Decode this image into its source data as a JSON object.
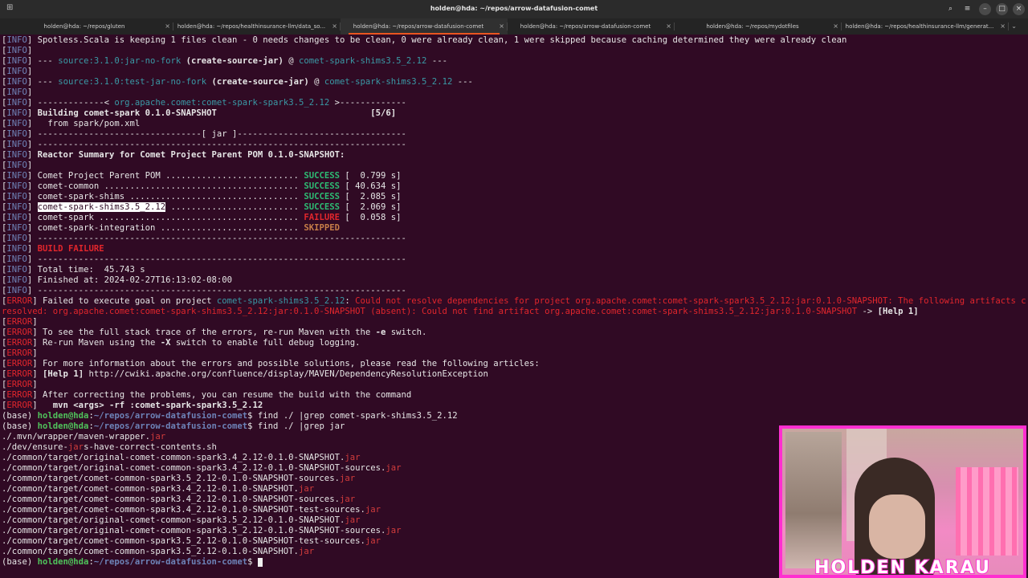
{
  "titlebar": {
    "title": "holden@hda: ~/repos/arrow-datafusion-comet",
    "newtab_icon": "new-tab-icon",
    "search_icon": "search-icon",
    "menu_icon": "hamburger-icon"
  },
  "tabs": [
    {
      "label": "holden@hda: ~/repos/gluten",
      "active": false
    },
    {
      "label": "holden@hda: ~/repos/healthinsurance-llm/data_so...",
      "active": false
    },
    {
      "label": "holden@hda: ~/repos/arrow-datafusion-comet",
      "active": true
    },
    {
      "label": "holden@hda: ~/repos/arrow-datafusion-comet",
      "active": false
    },
    {
      "label": "holden@hda: ~/repos/mydotfiles",
      "active": false
    },
    {
      "label": "holden@hda: ~/repos/healthinsurance-llm/generat...",
      "active": false
    }
  ],
  "colors": {
    "background": "#300a24",
    "info": "#6f84b8",
    "error": "#e2262c",
    "success": "#2dbb73",
    "skipped": "#c67d48",
    "prompt": "#4fc35b",
    "webcam_border": "#ff2fd0"
  },
  "terminal": {
    "lines": [
      [
        {
          "t": "[",
          "c": ""
        },
        {
          "t": "INFO",
          "c": "info"
        },
        {
          "t": "] Spotless.Scala is keeping 1 files clean - 0 needs changes to be clean, 0 were already clean, 1 were skipped because caching determined they were already clean",
          "c": ""
        }
      ],
      [
        {
          "t": "[",
          "c": ""
        },
        {
          "t": "INFO",
          "c": "info"
        },
        {
          "t": "]",
          "c": ""
        }
      ],
      [
        {
          "t": "[",
          "c": ""
        },
        {
          "t": "INFO",
          "c": "info"
        },
        {
          "t": "] --- ",
          "c": ""
        },
        {
          "t": "source:3.1.0:jar-no-fork",
          "c": "teal"
        },
        {
          "t": " ",
          "c": ""
        },
        {
          "t": "(create-source-jar)",
          "c": "b"
        },
        {
          "t": " @ ",
          "c": ""
        },
        {
          "t": "comet-spark-shims3.5_2.12",
          "c": "teal"
        },
        {
          "t": " ---",
          "c": ""
        }
      ],
      [
        {
          "t": "[",
          "c": ""
        },
        {
          "t": "INFO",
          "c": "info"
        },
        {
          "t": "]",
          "c": ""
        }
      ],
      [
        {
          "t": "[",
          "c": ""
        },
        {
          "t": "INFO",
          "c": "info"
        },
        {
          "t": "] --- ",
          "c": ""
        },
        {
          "t": "source:3.1.0:test-jar-no-fork",
          "c": "teal"
        },
        {
          "t": " ",
          "c": ""
        },
        {
          "t": "(create-source-jar)",
          "c": "b"
        },
        {
          "t": " @ ",
          "c": ""
        },
        {
          "t": "comet-spark-shims3.5_2.12",
          "c": "teal"
        },
        {
          "t": " ---",
          "c": ""
        }
      ],
      [
        {
          "t": "[",
          "c": ""
        },
        {
          "t": "INFO",
          "c": "info"
        },
        {
          "t": "]",
          "c": ""
        }
      ],
      [
        {
          "t": "[",
          "c": ""
        },
        {
          "t": "INFO",
          "c": "info"
        },
        {
          "t": "] -------------< ",
          "c": ""
        },
        {
          "t": "org.apache.comet:comet-spark-spark3.5_2.12",
          "c": "teal"
        },
        {
          "t": " >-------------",
          "c": ""
        }
      ],
      [
        {
          "t": "[",
          "c": ""
        },
        {
          "t": "INFO",
          "c": "info"
        },
        {
          "t": "] ",
          "c": ""
        },
        {
          "t": "Building comet-spark 0.1.0-SNAPSHOT                              [5/6]",
          "c": "b"
        }
      ],
      [
        {
          "t": "[",
          "c": ""
        },
        {
          "t": "INFO",
          "c": "info"
        },
        {
          "t": "]   from spark/pom.xml",
          "c": ""
        }
      ],
      [
        {
          "t": "[",
          "c": ""
        },
        {
          "t": "INFO",
          "c": "info"
        },
        {
          "t": "] --------------------------------[ jar ]---------------------------------",
          "c": ""
        }
      ],
      [
        {
          "t": "[",
          "c": ""
        },
        {
          "t": "INFO",
          "c": "info"
        },
        {
          "t": "] ------------------------------------------------------------------------",
          "c": ""
        }
      ],
      [
        {
          "t": "[",
          "c": ""
        },
        {
          "t": "INFO",
          "c": "info"
        },
        {
          "t": "] ",
          "c": ""
        },
        {
          "t": "Reactor Summary for Comet Project Parent POM 0.1.0-SNAPSHOT:",
          "c": "b"
        }
      ],
      [
        {
          "t": "[",
          "c": ""
        },
        {
          "t": "INFO",
          "c": "info"
        },
        {
          "t": "]",
          "c": ""
        }
      ],
      [
        {
          "t": "[",
          "c": ""
        },
        {
          "t": "INFO",
          "c": "info"
        },
        {
          "t": "] Comet Project Parent POM .......................... ",
          "c": ""
        },
        {
          "t": "SUCCESS",
          "c": "green"
        },
        {
          "t": " [  0.799 s]",
          "c": ""
        }
      ],
      [
        {
          "t": "[",
          "c": ""
        },
        {
          "t": "INFO",
          "c": "info"
        },
        {
          "t": "] comet-common ...................................... ",
          "c": ""
        },
        {
          "t": "SUCCESS",
          "c": "green"
        },
        {
          "t": " [ 40.634 s]",
          "c": ""
        }
      ],
      [
        {
          "t": "[",
          "c": ""
        },
        {
          "t": "INFO",
          "c": "info"
        },
        {
          "t": "] comet-spark-shims ................................. ",
          "c": ""
        },
        {
          "t": "SUCCESS",
          "c": "green"
        },
        {
          "t": " [  2.085 s]",
          "c": ""
        }
      ],
      [
        {
          "t": "[",
          "c": ""
        },
        {
          "t": "INFO",
          "c": "info"
        },
        {
          "t": "] ",
          "c": ""
        },
        {
          "t": "comet-spark-shims3.5_2.12",
          "c": "hl"
        },
        {
          "t": " ......................... ",
          "c": ""
        },
        {
          "t": "SUCCESS",
          "c": "green"
        },
        {
          "t": " [  2.069 s]",
          "c": ""
        }
      ],
      [
        {
          "t": "[",
          "c": ""
        },
        {
          "t": "INFO",
          "c": "info"
        },
        {
          "t": "] comet-spark ....................................... ",
          "c": ""
        },
        {
          "t": "FAILURE",
          "c": "red"
        },
        {
          "t": " [  0.058 s]",
          "c": ""
        }
      ],
      [
        {
          "t": "[",
          "c": ""
        },
        {
          "t": "INFO",
          "c": "info"
        },
        {
          "t": "] comet-spark-integration ........................... ",
          "c": ""
        },
        {
          "t": "SKIPPED",
          "c": "amber"
        }
      ],
      [
        {
          "t": "[",
          "c": ""
        },
        {
          "t": "INFO",
          "c": "info"
        },
        {
          "t": "] ------------------------------------------------------------------------",
          "c": ""
        }
      ],
      [
        {
          "t": "[",
          "c": ""
        },
        {
          "t": "INFO",
          "c": "info"
        },
        {
          "t": "] ",
          "c": ""
        },
        {
          "t": "BUILD FAILURE",
          "c": "red"
        }
      ],
      [
        {
          "t": "[",
          "c": ""
        },
        {
          "t": "INFO",
          "c": "info"
        },
        {
          "t": "] ------------------------------------------------------------------------",
          "c": ""
        }
      ],
      [
        {
          "t": "[",
          "c": ""
        },
        {
          "t": "INFO",
          "c": "info"
        },
        {
          "t": "] Total time:  45.743 s",
          "c": ""
        }
      ],
      [
        {
          "t": "[",
          "c": ""
        },
        {
          "t": "INFO",
          "c": "info"
        },
        {
          "t": "] Finished at: 2024-02-27T16:13:02-08:00",
          "c": ""
        }
      ],
      [
        {
          "t": "[",
          "c": ""
        },
        {
          "t": "INFO",
          "c": "info"
        },
        {
          "t": "] ------------------------------------------------------------------------",
          "c": ""
        }
      ],
      [
        {
          "t": "[",
          "c": ""
        },
        {
          "t": "ERROR",
          "c": "err"
        },
        {
          "t": "] Failed to execute goal on project ",
          "c": ""
        },
        {
          "t": "comet-spark-shims3.5_2.12",
          "c": "teal"
        },
        {
          "t": ": ",
          "c": ""
        },
        {
          "t": "Could not resolve dependencies for project org.apache.comet:comet-spark-spark3.5_2.12:jar:0.1.0-SNAPSHOT: The following artifacts could not be",
          "c": "err"
        }
      ],
      [
        {
          "t": "resolved: org.apache.comet:comet-spark-shims3.5_2.12:jar:0.1.0-SNAPSHOT (absent): Could not find artifact org.apache.comet:comet-spark-shims3.5_2.12:jar:0.1.0-SNAPSHOT",
          "c": "err"
        },
        {
          "t": " -> ",
          "c": ""
        },
        {
          "t": "[Help 1]",
          "c": "b"
        }
      ],
      [
        {
          "t": "[",
          "c": ""
        },
        {
          "t": "ERROR",
          "c": "err"
        },
        {
          "t": "]",
          "c": ""
        }
      ],
      [
        {
          "t": "[",
          "c": ""
        },
        {
          "t": "ERROR",
          "c": "err"
        },
        {
          "t": "] To see the full stack trace of the errors, re-run Maven with the ",
          "c": ""
        },
        {
          "t": "-e",
          "c": "b"
        },
        {
          "t": " switch.",
          "c": ""
        }
      ],
      [
        {
          "t": "[",
          "c": ""
        },
        {
          "t": "ERROR",
          "c": "err"
        },
        {
          "t": "] Re-run Maven using the ",
          "c": ""
        },
        {
          "t": "-X",
          "c": "b"
        },
        {
          "t": " switch to enable full debug logging.",
          "c": ""
        }
      ],
      [
        {
          "t": "[",
          "c": ""
        },
        {
          "t": "ERROR",
          "c": "err"
        },
        {
          "t": "]",
          "c": ""
        }
      ],
      [
        {
          "t": "[",
          "c": ""
        },
        {
          "t": "ERROR",
          "c": "err"
        },
        {
          "t": "] For more information about the errors and possible solutions, please read the following articles:",
          "c": ""
        }
      ],
      [
        {
          "t": "[",
          "c": ""
        },
        {
          "t": "ERROR",
          "c": "err"
        },
        {
          "t": "] ",
          "c": ""
        },
        {
          "t": "[Help 1]",
          "c": "b"
        },
        {
          "t": " http://cwiki.apache.org/confluence/display/MAVEN/DependencyResolutionException",
          "c": ""
        }
      ],
      [
        {
          "t": "[",
          "c": ""
        },
        {
          "t": "ERROR",
          "c": "err"
        },
        {
          "t": "]",
          "c": ""
        }
      ],
      [
        {
          "t": "[",
          "c": ""
        },
        {
          "t": "ERROR",
          "c": "err"
        },
        {
          "t": "] After correcting the problems, you can resume the build with the command",
          "c": ""
        }
      ],
      [
        {
          "t": "[",
          "c": ""
        },
        {
          "t": "ERROR",
          "c": "err"
        },
        {
          "t": "]   ",
          "c": ""
        },
        {
          "t": "mvn <args> -rf :comet-spark-spark3.5_2.12",
          "c": "b"
        }
      ],
      [
        {
          "t": "(base) ",
          "c": ""
        },
        {
          "t": "holden@hda",
          "c": "prompt"
        },
        {
          "t": ":",
          "c": ""
        },
        {
          "t": "~/repos/arrow-datafusion-comet",
          "c": "path"
        },
        {
          "t": "$ find ./ |grep comet-spark-shims3.5_2.12",
          "c": ""
        }
      ],
      [
        {
          "t": "(base) ",
          "c": ""
        },
        {
          "t": "holden@hda",
          "c": "prompt"
        },
        {
          "t": ":",
          "c": ""
        },
        {
          "t": "~/repos/arrow-datafusion-comet",
          "c": "path"
        },
        {
          "t": "$ find ./ |grep jar",
          "c": ""
        }
      ],
      [
        {
          "t": "./.mvn/wrapper/maven-wrapper.",
          "c": ""
        },
        {
          "t": "jar",
          "c": "jar"
        }
      ],
      [
        {
          "t": "./dev/ensure-",
          "c": ""
        },
        {
          "t": "jar",
          "c": "jar"
        },
        {
          "t": "s-have-correct-contents.sh",
          "c": ""
        }
      ],
      [
        {
          "t": "./common/target/original-comet-common-spark3.4_2.12-0.1.0-SNAPSHOT.",
          "c": ""
        },
        {
          "t": "jar",
          "c": "jar"
        }
      ],
      [
        {
          "t": "./common/target/original-comet-common-spark3.4_2.12-0.1.0-SNAPSHOT-sources.",
          "c": ""
        },
        {
          "t": "jar",
          "c": "jar"
        }
      ],
      [
        {
          "t": "./common/target/comet-common-spark3.5_2.12-0.1.0-SNAPSHOT-sources.",
          "c": ""
        },
        {
          "t": "jar",
          "c": "jar"
        }
      ],
      [
        {
          "t": "./common/target/comet-common-spark3.4_2.12-0.1.0-SNAPSHOT.",
          "c": ""
        },
        {
          "t": "jar",
          "c": "jar"
        }
      ],
      [
        {
          "t": "./common/target/comet-common-spark3.4_2.12-0.1.0-SNAPSHOT-sources.",
          "c": ""
        },
        {
          "t": "jar",
          "c": "jar"
        }
      ],
      [
        {
          "t": "./common/target/comet-common-spark3.4_2.12-0.1.0-SNAPSHOT-test-sources.",
          "c": ""
        },
        {
          "t": "jar",
          "c": "jar"
        }
      ],
      [
        {
          "t": "./common/target/original-comet-common-spark3.5_2.12-0.1.0-SNAPSHOT.",
          "c": ""
        },
        {
          "t": "jar",
          "c": "jar"
        }
      ],
      [
        {
          "t": "./common/target/original-comet-common-spark3.5_2.12-0.1.0-SNAPSHOT-sources.",
          "c": ""
        },
        {
          "t": "jar",
          "c": "jar"
        }
      ],
      [
        {
          "t": "./common/target/comet-common-spark3.5_2.12-0.1.0-SNAPSHOT-test-sources.",
          "c": ""
        },
        {
          "t": "jar",
          "c": "jar"
        }
      ],
      [
        {
          "t": "./common/target/comet-common-spark3.5_2.12-0.1.0-SNAPSHOT.",
          "c": ""
        },
        {
          "t": "jar",
          "c": "jar"
        }
      ],
      [
        {
          "t": "(base) ",
          "c": ""
        },
        {
          "t": "holden@hda",
          "c": "prompt"
        },
        {
          "t": ":",
          "c": ""
        },
        {
          "t": "~/repos/arrow-datafusion-comet",
          "c": "path"
        },
        {
          "t": "$ ",
          "c": ""
        },
        {
          "t": "",
          "c": "cursor"
        }
      ]
    ]
  },
  "webcam": {
    "name_overlay": "HOLDEN KARAU"
  }
}
